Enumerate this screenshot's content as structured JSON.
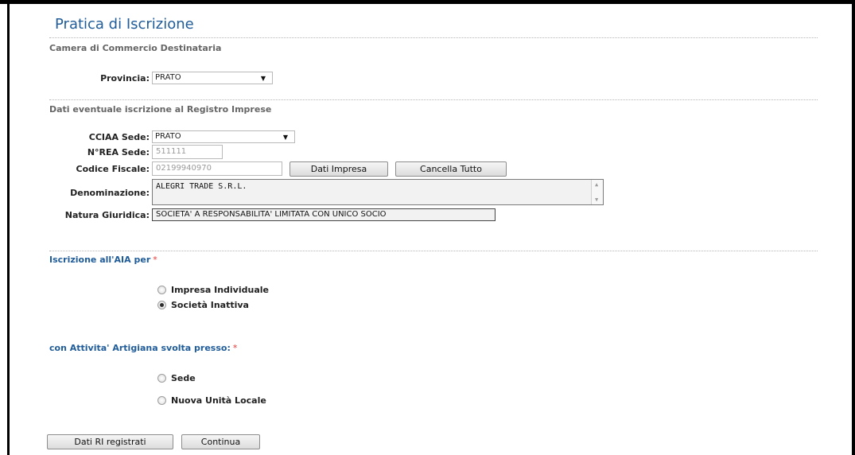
{
  "page_title": "Pratica di Iscrizione",
  "sections": {
    "camera": "Camera di Commercio Destinataria",
    "registro": "Dati eventuale iscrizione al Registro Imprese",
    "iscrizione_aia": "Iscrizione all'AIA per",
    "attivita": "con Attivita' Artigiana svolta presso:"
  },
  "required_marker": "*",
  "provincia": {
    "label": "Provincia:",
    "value": "PRATO"
  },
  "cciaa_sede": {
    "label": "CCIAA Sede:",
    "value": "PRATO"
  },
  "nrea_sede": {
    "label": "N°REA Sede:",
    "value": "511111"
  },
  "codice_fiscale": {
    "label": "Codice Fiscale:",
    "value": "02199940970"
  },
  "denominazione": {
    "label": "Denominazione:",
    "value": "ALEGRI TRADE S.R.L."
  },
  "natura_giuridica": {
    "label": "Natura Giuridica:",
    "value": "SOCIETA' A RESPONSABILITA' LIMITATA CON UNICO SOCIO"
  },
  "buttons": {
    "dati_impresa": "Dati Impresa",
    "cancella_tutto": "Cancella Tutto",
    "dati_ri_registrati": "Dati RI registrati",
    "continua": "Continua"
  },
  "aia_options": [
    {
      "label": "Impresa Individuale",
      "checked": false
    },
    {
      "label": "Società Inattiva",
      "checked": true
    }
  ],
  "attivita_options": [
    {
      "label": "Sede",
      "checked": false
    },
    {
      "label": "Nuova Unità Locale",
      "checked": false
    }
  ],
  "icons": {
    "dropdown": "chevron-down-icon",
    "scroll_up": "scroll-up-icon",
    "scroll_down": "scroll-down-icon"
  }
}
